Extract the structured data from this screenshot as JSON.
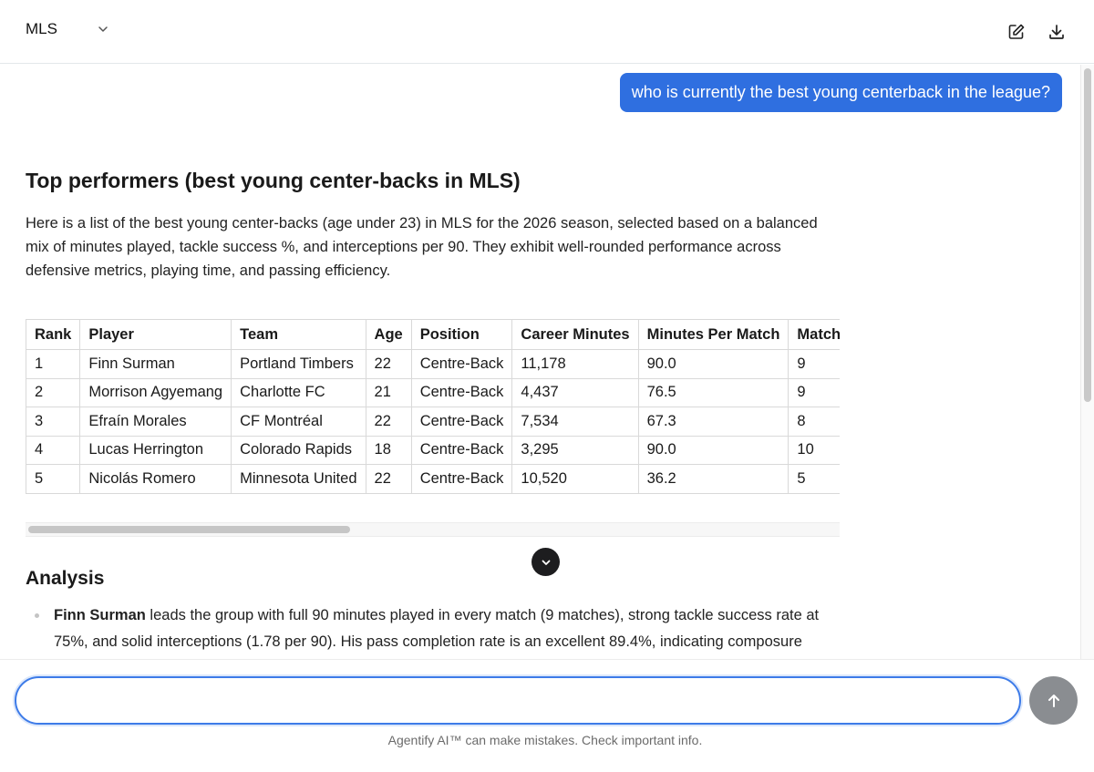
{
  "header": {
    "model_name": "MLS"
  },
  "chat": {
    "user_message": "who is currently the best young centerback in the league?",
    "response": {
      "title": "Top performers (best young center-backs in MLS)",
      "intro": "Here is a list of the best young center-backs (age under 23) in MLS for the 2026 season, selected based on a balanced mix of minutes played, tackle success %, and interceptions per 90. They exhibit well-rounded performance across defensive metrics, playing time, and passing efficiency.",
      "table": {
        "headers": [
          "Rank",
          "Player",
          "Team",
          "Age",
          "Position",
          "Career Minutes",
          "Minutes Per Match",
          "Matches Pla"
        ],
        "rows": [
          [
            "1",
            "Finn Surman",
            "Portland Timbers",
            "22",
            "Centre-Back",
            "11,178",
            "90.0",
            "9"
          ],
          [
            "2",
            "Morrison Agyemang",
            "Charlotte FC",
            "21",
            "Centre-Back",
            "4,437",
            "76.5",
            "9"
          ],
          [
            "3",
            "Efraín Morales",
            "CF Montréal",
            "22",
            "Centre-Back",
            "7,534",
            "67.3",
            "8"
          ],
          [
            "4",
            "Lucas Herrington",
            "Colorado Rapids",
            "18",
            "Centre-Back",
            "3,295",
            "90.0",
            "10"
          ],
          [
            "5",
            "Nicolás Romero",
            "Minnesota United",
            "22",
            "Centre-Back",
            "10,520",
            "36.2",
            "5"
          ]
        ]
      },
      "analysis_title": "Analysis",
      "analysis_items": [
        {
          "bold": "Finn Surman",
          "text": " leads the group with full 90 minutes played in every match (9 matches), strong tackle success rate at 75%, and solid interceptions (1.78 per 90). His pass completion rate is an excellent 89.4%, indicating composure under pressure and good distribution."
        }
      ]
    }
  },
  "composer": {
    "input_value": "",
    "placeholder": "",
    "disclaimer": "Agentify AI™ can make mistakes. Check important info."
  },
  "icons": {
    "model_dropdown": "chevron-down-icon",
    "edit": "edit-icon",
    "download": "download-icon",
    "scroll_down": "arrow-down-icon",
    "send": "arrow-up-icon"
  },
  "colors": {
    "user_bubble": "#2f6fe0",
    "input_focus": "#3d7be8",
    "send_disabled": "#8a8d91"
  }
}
